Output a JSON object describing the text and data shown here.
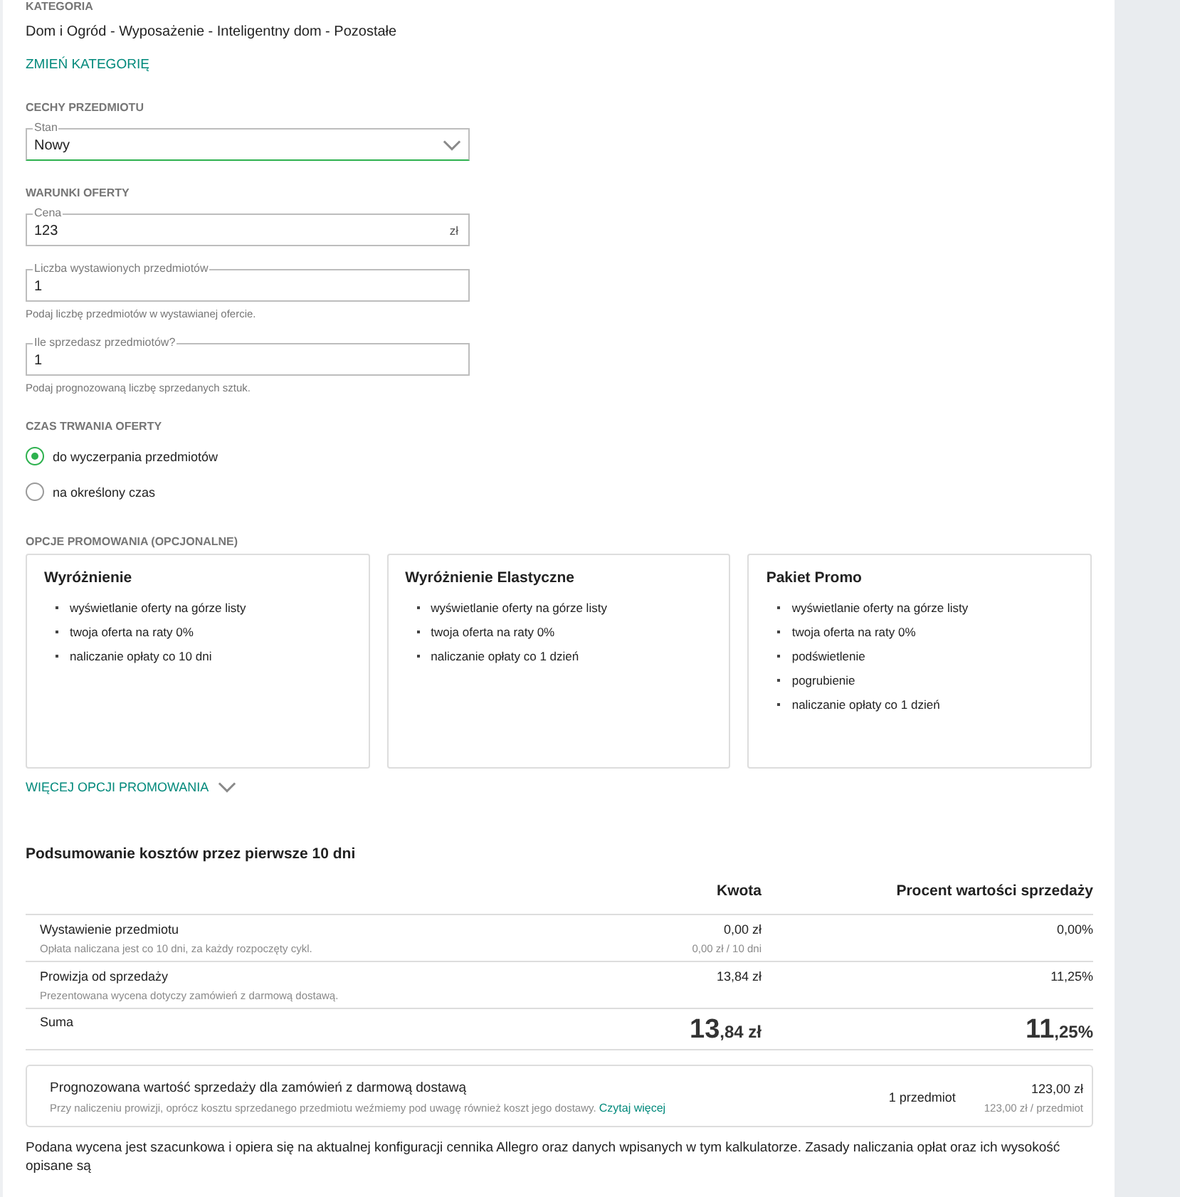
{
  "category": {
    "label": "KATEGORIA",
    "path": "Dom i Ogród - Wyposażenie - Inteligentny dom - Pozostałe",
    "change_link": "ZMIEŃ KATEGORIĘ"
  },
  "features": {
    "heading": "CECHY PRZEDMIOTU",
    "fields": [
      {
        "kind": "select",
        "label": "Stan",
        "value": "Nowy",
        "focused": true
      }
    ]
  },
  "offer_terms": {
    "heading": "WARUNKI OFERTY",
    "fields": [
      {
        "kind": "input",
        "label": "Cena",
        "value": "123",
        "suffix": "zł",
        "focused": false
      },
      {
        "kind": "input",
        "label": "Liczba wystawionych przedmiotów",
        "value": "1",
        "hint": "Podaj liczbę przedmiotów w wystawianej ofercie.",
        "focused": false
      },
      {
        "kind": "input",
        "label": "Ile sprzedasz przedmiotów?",
        "value": "1",
        "hint": "Podaj prognozowaną liczbę sprzedanych sztuk.",
        "focused": false
      }
    ]
  },
  "duration": {
    "heading": "CZAS TRWANIA OFERTY",
    "options": [
      {
        "label": "do wyczerpania przedmiotów",
        "selected": true
      },
      {
        "label": "na określony czas",
        "selected": false
      }
    ]
  },
  "promotion": {
    "heading": "OPCJE PROMOWANIA (OPCJONALNE)",
    "cards": [
      {
        "title": "Wyróżnienie",
        "features": [
          "wyświetlanie oferty na górze listy",
          "twoja oferta na raty 0%",
          "naliczanie opłaty co 10 dni"
        ]
      },
      {
        "title": "Wyróżnienie Elastyczne",
        "features": [
          "wyświetlanie oferty na górze listy",
          "twoja oferta na raty 0%",
          "naliczanie opłaty co 1 dzień"
        ]
      },
      {
        "title": "Pakiet Promo",
        "features": [
          "wyświetlanie oferty na górze listy",
          "twoja oferta na raty 0%",
          "podświetlenie",
          "pogrubienie",
          "naliczanie opłaty co 1 dzień"
        ]
      }
    ],
    "more_link": "WIĘCEJ OPCJI PROMOWANIA"
  },
  "summary": {
    "title": "Podsumowanie kosztów przez pierwsze 10 dni",
    "columns": [
      "Kwota",
      "Procent wartości sprzedaży"
    ],
    "rows": [
      {
        "name": "Wystawienie przedmiotu",
        "note": "Opłata naliczana jest co 10 dni, za każdy rozpoczęty cykl.",
        "amount": "0,00 zł",
        "amount_note": "0,00 zł / 10 dni",
        "percent": "0,00%"
      },
      {
        "name": "Prowizja od sprzedaży",
        "note": "Prezentowana wycena dotyczy zamówień z darmową dostawą.",
        "amount": "13,84 zł",
        "percent": "11,25%"
      }
    ],
    "total": {
      "name": "Suma",
      "amount_main": "13",
      "amount_rest": ",84 zł",
      "percent_main": "11",
      "percent_rest": ",25%"
    }
  },
  "forecast": {
    "title": "Prognozowana wartość sprzedaży dla zamówień z darmową dostawą",
    "note": "Przy naliczeniu prowizji, oprócz kosztu sprzedanego przedmiotu weźmiemy pod uwagę również koszt jego dostawy.",
    "link": "Czytaj więcej",
    "quantity": "1 przedmiot",
    "value": "123,00 zł",
    "unit_value": "123,00 zł / przedmiot"
  },
  "disclaimer": "Podana wycena jest szacunkowa i opiera się na aktualnej konfiguracji cennika Allegro oraz danych wpisanych w tym kalkulatorze. Zasady naliczania opłat oraz ich wysokość opisane są"
}
